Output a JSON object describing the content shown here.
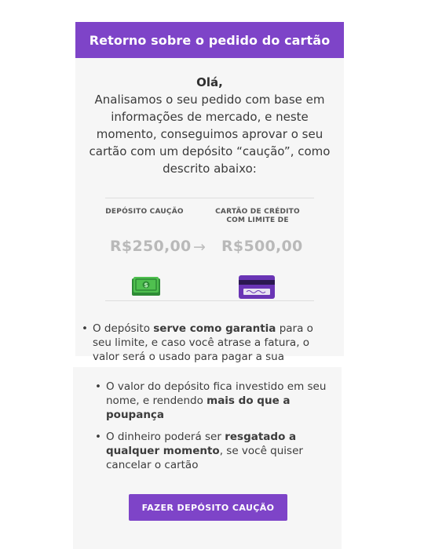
{
  "header": {
    "title": "Retorno sobre o pedido do cartão"
  },
  "greeting": "Olá,",
  "intro": "Analisamos o seu pedido com base em informações de mercado, e neste momento, conseguimos aprovar o seu cartão com um depósito “caução”, como descrito abaixo:",
  "offer": {
    "deposit_title": "DEPÓSITO CAUÇÃO",
    "deposit_amount": "R$250,00",
    "arrow": "→",
    "credit_title_line1": "CARTÃO DE CRÉDITO",
    "credit_title_line2": "COM LIMITE DE",
    "credit_amount": "R$500,00",
    "deposit_icon": "money-bill-icon",
    "credit_icon": "credit-card-icon"
  },
  "bullets_top": [
    {
      "before": "O depósito ",
      "bold": "serve como garantia",
      "after": " para o seu limite, e caso você atrase a fatura, o valor será o usado para pagar a sua"
    }
  ],
  "bullets_bottom": [
    {
      "before": "O valor do depósito fica investido em seu nome, e rendendo ",
      "bold": "mais do que a poupança",
      "after": ""
    },
    {
      "before": "O dinheiro poderá ser ",
      "bold": "resgatado a qualquer momento",
      "after": ", se você quiser cancelar o cartão"
    }
  ],
  "cta": {
    "label": "FAZER DEPÓSITO CAUÇÃO"
  },
  "colors": {
    "accent": "#7e44c8",
    "money_green": "#3cb043",
    "muted_amount": "#b9b9b9"
  }
}
